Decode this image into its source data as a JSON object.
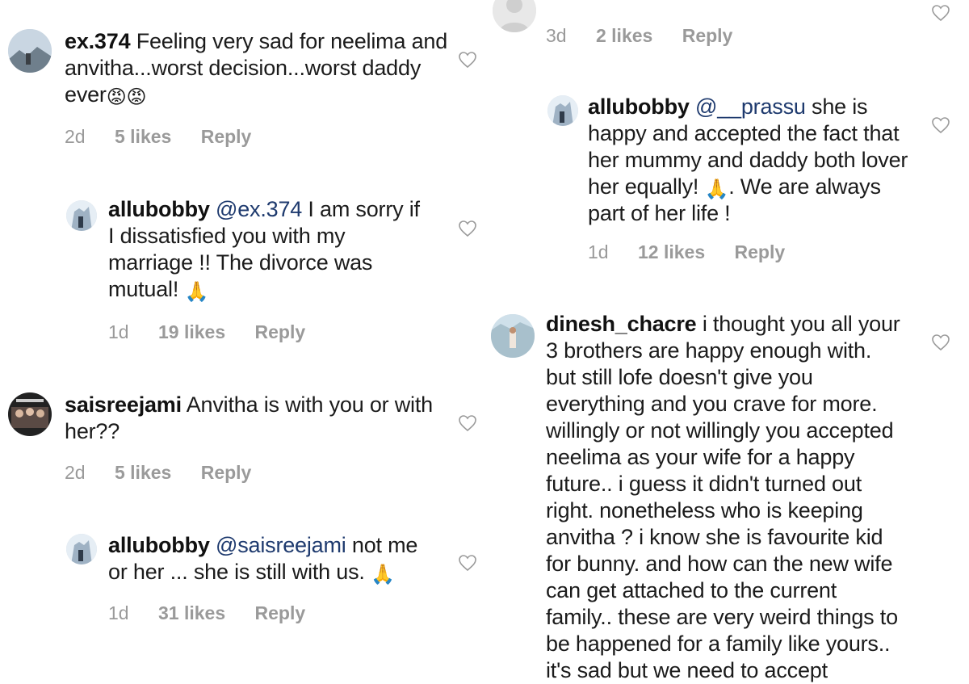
{
  "left": {
    "comments": [
      {
        "username": "ex.374",
        "text": "Feeling very sad for neelima and anvitha...worst decision...worst daddy ever",
        "emoji": "😡😡",
        "time": "2d",
        "likes": "5 likes",
        "reply": "Reply"
      },
      {
        "username": "allubobby",
        "mention": "@ex.374",
        "text": "I am sorry if I dissatisfied you with my marriage !! The divorce was mutual!",
        "emoji": "🙏",
        "time": "1d",
        "likes": "19 likes",
        "reply": "Reply"
      },
      {
        "username": "saisreejami",
        "text": "Anvitha is with you or with her??",
        "time": "2d",
        "likes": "5 likes",
        "reply": "Reply"
      },
      {
        "username": "allubobby",
        "mention": "@saisreejami",
        "text": "not me or her ... she is still with us.",
        "emoji": "🙏",
        "time": "1d",
        "likes": "31 likes",
        "reply": "Reply"
      }
    ]
  },
  "right": {
    "cut_top": {
      "time": "3d",
      "likes": "2 likes",
      "reply": "Reply"
    },
    "comments": [
      {
        "username": "allubobby",
        "mention": "@__prassu",
        "text_a": "she is happy and accepted the fact that her mummy and daddy both lover her equally!",
        "emoji": "🙏",
        "text_b": ". We are always part of her life !",
        "time": "1d",
        "likes": "12 likes",
        "reply": "Reply"
      },
      {
        "username": "dinesh_chacre",
        "text": "i thought you all your 3 brothers are happy enough with.  but still lofe doesn't give you everything and you crave for more. willingly or not willingly you accepted neelima as your wife for a happy future.. i guess it didn't turned out right. nonetheless who is keeping anvitha ? i know she is favourite kid for bunny. and how can the new wife can get attached to the current family.. these are very weird things to be happened for a family like yours.. it's sad but we need to accept"
      }
    ]
  },
  "icons": {
    "like": "heart-outline-icon"
  }
}
